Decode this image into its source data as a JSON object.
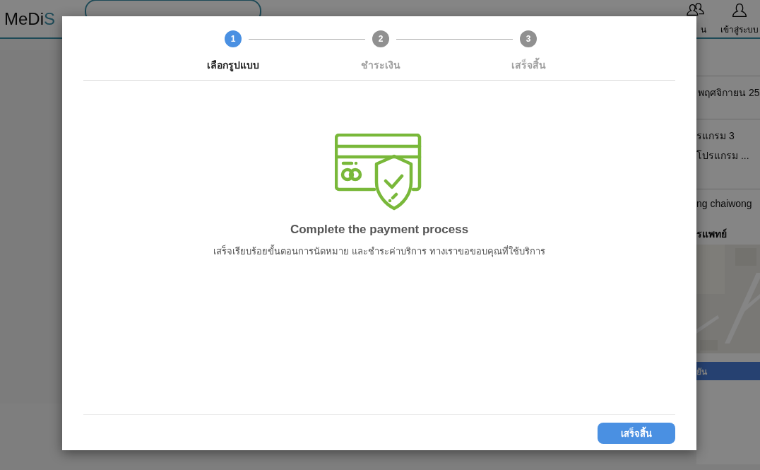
{
  "background_page": {
    "logo": {
      "dark": "MeDi",
      "accent": "S"
    },
    "nav": [
      {
        "label": "น"
      },
      {
        "label": "เข้าสู่ระบบ"
      }
    ],
    "side_panel": {
      "date": "พฤศจิกายน 25",
      "program_lines": [
        "รแกรม 3",
        "โปรแกรม ..."
      ],
      "name": "ng chaiwong",
      "section_title": "รแพทย์",
      "map": {
        "kind": "picture"
      },
      "button": "ยัน"
    }
  },
  "dialog": {
    "steps": [
      {
        "number": "1",
        "label": "เลือกรูปแบบ",
        "selected": true
      },
      {
        "number": "2",
        "label": "ชำระเงิน",
        "selected": false
      },
      {
        "number": "3",
        "label": "เสร็จสิ้น",
        "selected": false
      }
    ],
    "title": "Complete the payment process",
    "message": "เสร็จเรียบร้อยขั้นตอนการนัดหมาย และชำระค่าบริการ ทางเราขอขอบคุณที่ใช้บริการ",
    "button": "เสร็จสิ้น"
  }
}
